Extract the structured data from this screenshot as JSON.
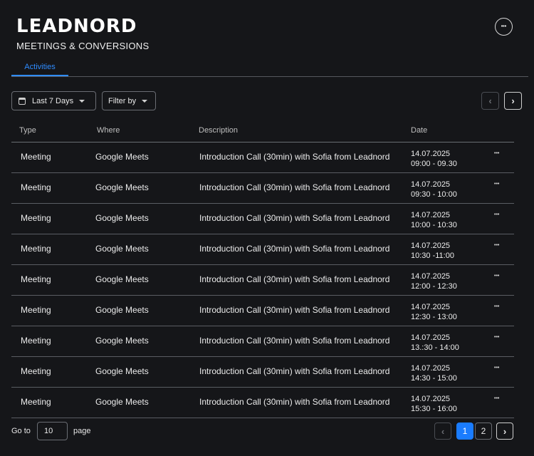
{
  "header": {
    "brand": "LEADNORD",
    "subtitle": "MEETINGS & CONVERSIONS",
    "more_icon": "•••"
  },
  "tabs": [
    {
      "label": "Activities",
      "active": true
    }
  ],
  "toolbar": {
    "date_range_label": "Last 7 Days",
    "filter_label": "Filter by",
    "prev_icon": "‹",
    "next_icon": "›"
  },
  "table": {
    "columns": [
      "Type",
      "Where",
      "Description",
      "Date"
    ],
    "rows": [
      {
        "type": "Meeting",
        "where": "Google Meets",
        "description": "Introduction Call (30min) with Sofia from Leadnord",
        "date": "14.07.2025",
        "time": "09:00 - 09.30"
      },
      {
        "type": "Meeting",
        "where": "Google Meets",
        "description": "Introduction Call (30min) with Sofia from Leadnord",
        "date": "14.07.2025",
        "time": "09:30 - 10:00"
      },
      {
        "type": "Meeting",
        "where": "Google Meets",
        "description": "Introduction Call (30min) with Sofia from Leadnord",
        "date": "14.07.2025",
        "time": "10:00 - 10:30"
      },
      {
        "type": "Meeting",
        "where": "Google Meets",
        "description": "Introduction Call (30min) with Sofia from Leadnord",
        "date": "14.07.2025",
        "time": "10:30 -11:00"
      },
      {
        "type": "Meeting",
        "where": "Google Meets",
        "description": "Introduction Call (30min) with Sofia from Leadnord",
        "date": "14.07.2025",
        "time": "12:00 - 12:30"
      },
      {
        "type": "Meeting",
        "where": "Google Meets",
        "description": "Introduction Call (30min) with Sofia from Leadnord",
        "date": "14.07.2025",
        "time": "12:30 - 13:00"
      },
      {
        "type": "Meeting",
        "where": "Google Meets",
        "description": "Introduction Call (30min) with Sofia from Leadnord",
        "date": "14.07.2025",
        "time": "13.:30 - 14:00"
      },
      {
        "type": "Meeting",
        "where": "Google Meets",
        "description": "Introduction Call (30min) with Sofia from Leadnord",
        "date": "14.07.2025",
        "time": "14:30 - 15:00"
      },
      {
        "type": "Meeting",
        "where": "Google Meets",
        "description": "Introduction Call (30min) with Sofia from Leadnord",
        "date": "14.07.2025",
        "time": "15:30 - 16:00"
      }
    ],
    "row_more_icon": "•••"
  },
  "pagination": {
    "goto_label": "Go to",
    "goto_value": "10",
    "page_label": "page",
    "pages": [
      "1",
      "2"
    ],
    "current_page": "1",
    "prev_icon": "‹",
    "next_icon": "›"
  },
  "colors": {
    "background": "#151619",
    "accent": "#1a7cff",
    "tab_active": "#2f8cff"
  }
}
